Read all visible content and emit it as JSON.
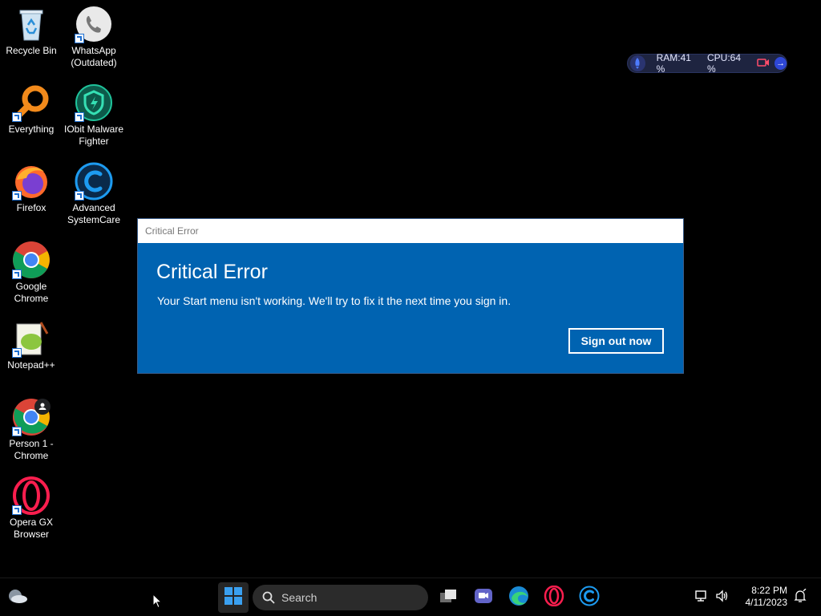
{
  "desktop": {
    "icons": [
      {
        "label": "Recycle Bin",
        "icon": "recycle-bin-icon"
      },
      {
        "label": "WhatsApp (Outdated)",
        "icon": "whatsapp-icon"
      },
      {
        "label": "Everything",
        "icon": "everything-search-icon"
      },
      {
        "label": "IObit Malware Fighter",
        "icon": "iobit-malware-fighter-icon"
      },
      {
        "label": "Firefox",
        "icon": "firefox-icon"
      },
      {
        "label": "Advanced SystemCare",
        "icon": "advanced-systemcare-icon"
      },
      {
        "label": "Google Chrome",
        "icon": "chrome-icon"
      },
      {
        "label": "Notepad++",
        "icon": "notepad-plus-plus-icon"
      },
      {
        "label": "Person 1 - Chrome",
        "icon": "chrome-profile-icon"
      },
      {
        "label": "Opera GX Browser",
        "icon": "opera-gx-icon"
      }
    ]
  },
  "perf_widget": {
    "ram": "RAM:41 %",
    "cpu": "CPU:64 %"
  },
  "dialog": {
    "window_title": "Critical Error",
    "heading": "Critical Error",
    "message": "Your Start menu isn't working. We'll try to fix it the next time you sign in.",
    "button_label": "Sign out now",
    "accent": "#0063b1"
  },
  "taskbar": {
    "search_placeholder": "Search",
    "apps": [
      "start-icon",
      "task-view-icon",
      "teams-chat-icon",
      "edge-icon",
      "opera-icon",
      "advanced-systemcare-icon"
    ],
    "time": "8:22 PM",
    "date": "4/11/2023"
  }
}
